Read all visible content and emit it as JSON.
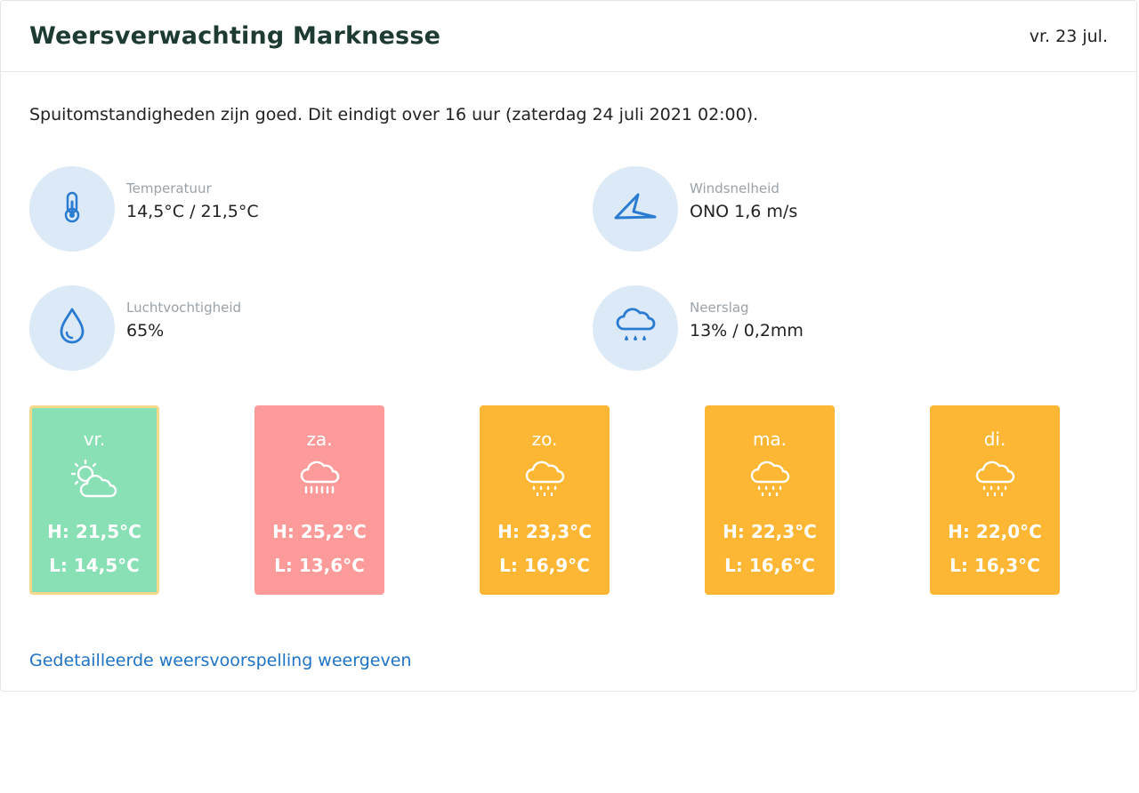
{
  "header": {
    "title": "Weersverwachting Marknesse",
    "date": "vr. 23 jul."
  },
  "summary": "Spuitomstandigheden zijn goed. Dit eindigt over 16 uur (zaterdag 24 juli 2021 02:00).",
  "stats": [
    {
      "label": "Temperatuur",
      "value": "14,5°C / 21,5°C",
      "icon": "thermometer-icon"
    },
    {
      "label": "Windsnelheid",
      "value": "ONO 1,6 m/s",
      "icon": "wind-direction-icon"
    },
    {
      "label": "Luchtvochtigheid",
      "value": "65%",
      "icon": "water-drop-icon"
    },
    {
      "label": "Neerslag",
      "value": "13% / 0,2mm",
      "icon": "rain-cloud-icon"
    }
  ],
  "forecast": [
    {
      "day": "vr.",
      "high": "H: 21,5°C",
      "low": "L: 14,5°C",
      "icon": "partly-cloudy-icon",
      "color": "#88e0b4",
      "selected": true
    },
    {
      "day": "za.",
      "high": "H: 25,2°C",
      "low": "L: 13,6°C",
      "icon": "rain-cloud-icon",
      "color": "#fd9b9b",
      "selected": false
    },
    {
      "day": "zo.",
      "high": "H: 23,3°C",
      "low": "L: 16,9°C",
      "icon": "light-rain-icon",
      "color": "#fdb734",
      "selected": false
    },
    {
      "day": "ma.",
      "high": "H: 22,3°C",
      "low": "L: 16,6°C",
      "icon": "light-rain-icon",
      "color": "#fdb734",
      "selected": false
    },
    {
      "day": "di.",
      "high": "H: 22,0°C",
      "low": "L: 16,3°C",
      "icon": "light-rain-icon",
      "color": "#fdb734",
      "selected": false
    }
  ],
  "link": "Gedetailleerde weersvoorspelling weergeven",
  "colors": {
    "accent": "#1f72c4",
    "icon_blue": "#2a7bd2",
    "circle_bg": "#dce9f7"
  }
}
